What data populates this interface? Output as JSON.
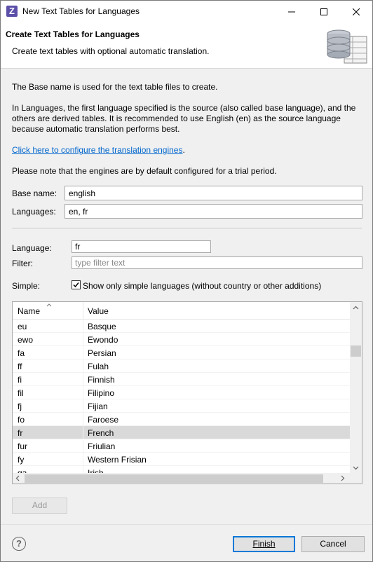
{
  "window": {
    "title": "New Text Tables for Languages",
    "app_icon_letter": "Z"
  },
  "banner": {
    "title": "Create Text Tables for Languages",
    "subtitle": "Create text tables with optional automatic translation."
  },
  "info": {
    "para1": "The Base name is used for the text table files to create.",
    "para2_line1": "In Languages, the first language specified is the source (also called base language), and the",
    "para2_line2": "others are derived tables. It is recommended to use English (en) as the source language",
    "para2_line3": "because automatic translation performs best.",
    "link": "Click here to configure the translation engines",
    "link_suffix": ".",
    "para3": "Please note that the engines are by default configured for a trial period."
  },
  "form": {
    "base_name_label": "Base name:",
    "base_name_value": "english",
    "languages_label": "Languages:",
    "languages_value": "en, fr",
    "language_label": "Language:",
    "language_value": "fr",
    "filter_label": "Filter:",
    "filter_placeholder": "type filter text",
    "simple_label": "Simple:",
    "simple_checkbox_label": "Show only simple languages (without country or other additions)",
    "simple_checked": true
  },
  "table": {
    "columns": [
      "Name",
      "Value"
    ],
    "rows": [
      {
        "name": "eu",
        "value": "Basque"
      },
      {
        "name": "ewo",
        "value": "Ewondo"
      },
      {
        "name": "fa",
        "value": "Persian"
      },
      {
        "name": "ff",
        "value": "Fulah"
      },
      {
        "name": "fi",
        "value": "Finnish"
      },
      {
        "name": "fil",
        "value": "Filipino"
      },
      {
        "name": "fj",
        "value": "Fijian"
      },
      {
        "name": "fo",
        "value": "Faroese"
      },
      {
        "name": "fr",
        "value": "French",
        "selected": true
      },
      {
        "name": "fur",
        "value": "Friulian"
      },
      {
        "name": "fy",
        "value": "Western Frisian"
      },
      {
        "name": "ga",
        "value": "Irish"
      }
    ]
  },
  "buttons": {
    "add": "Add",
    "finish": "Finish",
    "cancel": "Cancel",
    "help": "?"
  }
}
